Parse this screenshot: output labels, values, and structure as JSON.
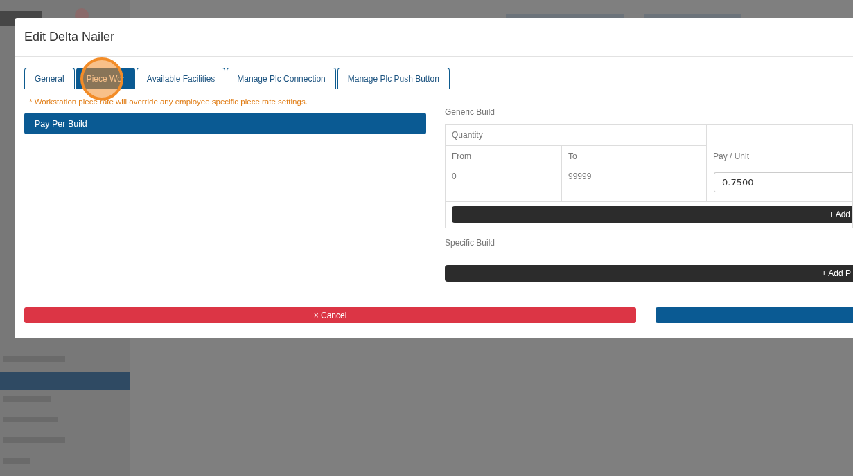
{
  "dialog": {
    "title": "Edit Delta Nailer"
  },
  "tabs": [
    {
      "label": "General",
      "selected": false
    },
    {
      "label": "Piece Wor",
      "selected": true
    },
    {
      "label": "Available Facilities",
      "selected": false
    },
    {
      "label": "Manage Plc Connection",
      "selected": false
    },
    {
      "label": "Manage Plc Push Button",
      "selected": false
    }
  ],
  "note": "* Workstation piece rate will override any employee specific piece rate settings.",
  "pay_options": [
    {
      "label": "Pay Per Build",
      "selected": true
    }
  ],
  "generic_build": {
    "title": "Generic Build",
    "group_header": "Quantity",
    "columns": [
      "From",
      "To",
      "Pay / Unit"
    ],
    "rows": [
      {
        "from": "0",
        "to": "99999",
        "pay_per_unit": "0.7500"
      }
    ],
    "add_button": "+ Add"
  },
  "specific_build": {
    "title": "Specific Build",
    "add_button": "+ Add P"
  },
  "footer": {
    "buttons": [
      {
        "kind": "danger",
        "label": "× Cancel"
      },
      {
        "kind": "primary"
      }
    ]
  }
}
